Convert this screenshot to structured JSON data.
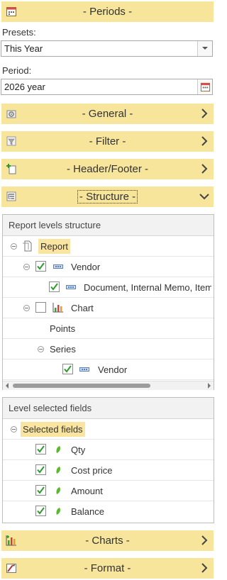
{
  "periods": {
    "title": "- Periods -"
  },
  "presets": {
    "label": "Presets:",
    "value": "This Year"
  },
  "period": {
    "label": "Period:",
    "value": "2026 year"
  },
  "sections": {
    "general": "- General -",
    "filter": "- Filter -",
    "header_footer": "- Header/Footer -",
    "structure": "- Structure -",
    "charts": "- Charts -",
    "format": "- Format -"
  },
  "structure_panel": {
    "title": "Report levels structure",
    "rows": [
      {
        "label": "Report"
      },
      {
        "label": "Vendor"
      },
      {
        "label": "Document, Internal Memo, Item"
      },
      {
        "label": "Chart"
      },
      {
        "label": "Points"
      },
      {
        "label": "Series"
      },
      {
        "label": "Vendor"
      }
    ],
    "scroll_position": 0.72
  },
  "fields_panel": {
    "title": "Level selected fields",
    "root": "Selected fields",
    "fields": [
      {
        "label": "Qty"
      },
      {
        "label": "Cost price"
      },
      {
        "label": "Amount"
      },
      {
        "label": "Balance"
      }
    ]
  },
  "colors": {
    "section_bg": "#f6e59b",
    "highlight": "#f9e5a0",
    "check": "#2e9b2e",
    "chevron": "#444444"
  }
}
